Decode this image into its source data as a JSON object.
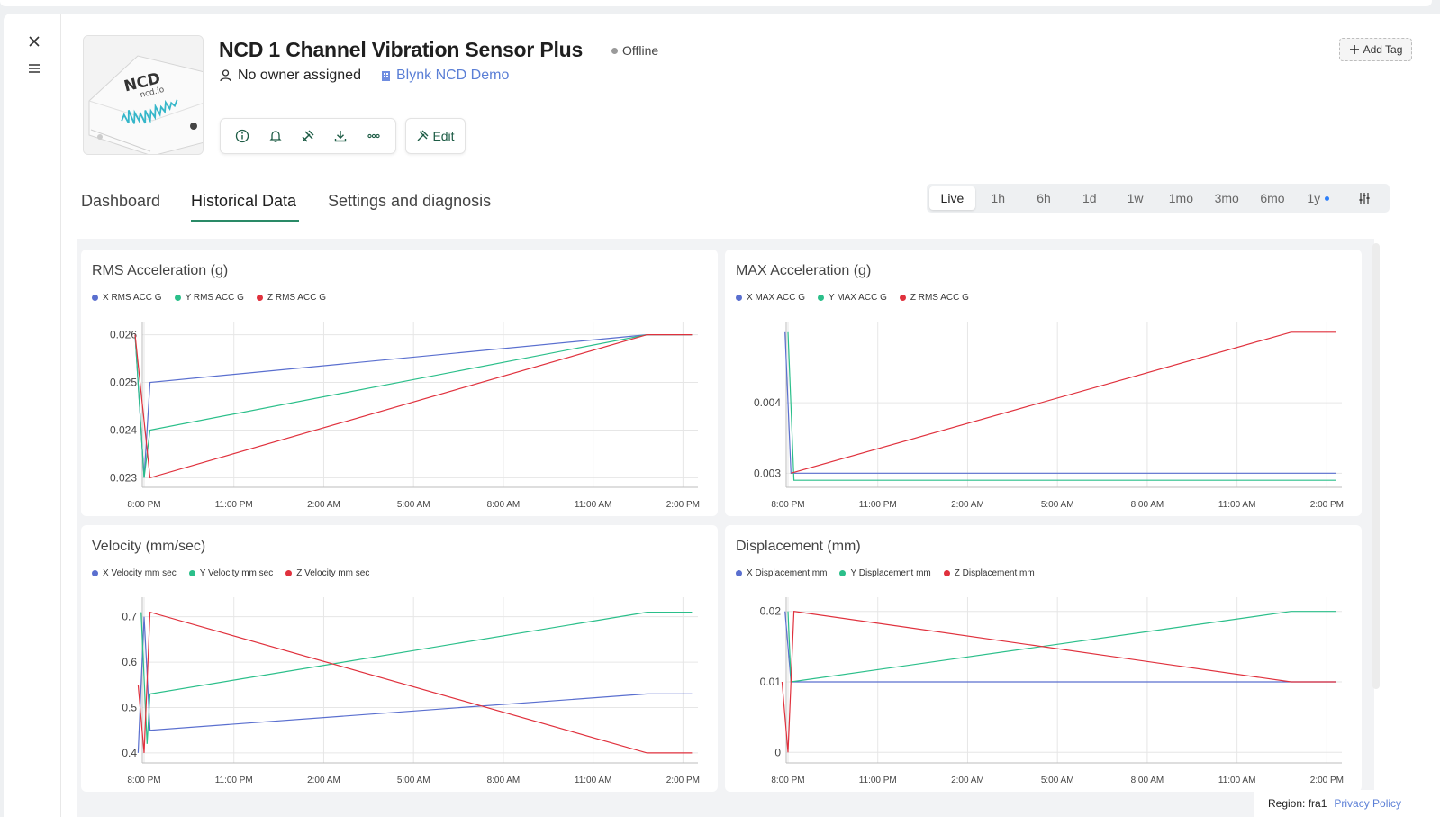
{
  "device": {
    "title": "NCD 1 Channel Vibration Sensor Plus",
    "status": "Offline",
    "owner": "No owner assigned",
    "organization": "Blynk NCD Demo",
    "add_tag_label": "Add Tag",
    "edit_label": "Edit",
    "thumbnail": {
      "logo_text": "NCD",
      "brand_text": "ncd.io"
    }
  },
  "tabs": [
    {
      "label": "Dashboard",
      "active": false
    },
    {
      "label": "Historical Data",
      "active": true
    },
    {
      "label": "Settings and diagnosis",
      "active": false
    }
  ],
  "time_ranges": [
    "Live",
    "1h",
    "6h",
    "1d",
    "1w",
    "1mo",
    "3mo",
    "6mo",
    "1y"
  ],
  "active_range": "Live",
  "colors": {
    "series_x": "#5a6fcf",
    "series_y": "#2bbf8a",
    "series_z": "#e0313d",
    "accent": "#2a8a67",
    "link": "#5b7fd6"
  },
  "footer": {
    "region": "Region: fra1",
    "privacy": "Privacy Policy"
  },
  "chart_data": [
    {
      "type": "line",
      "title": "RMS Acceleration (g)",
      "x": [
        "8:00 PM",
        "11:00 PM",
        "2:00 AM",
        "5:00 AM",
        "8:00 AM",
        "11:00 AM",
        "2:00 PM"
      ],
      "x_range": [
        0,
        18.5
      ],
      "ylim": [
        0.0228,
        0.0262
      ],
      "yticks": [
        "0.023",
        "0.024",
        "0.025",
        "0.026"
      ],
      "ytick_values": [
        0.023,
        0.024,
        0.025,
        0.026
      ],
      "series": [
        {
          "name": "X RMS ACC G",
          "color": "#5a6fcf",
          "points": [
            [
              -0.3,
              0.026
            ],
            [
              0,
              0.023
            ],
            [
              0.2,
              0.025
            ],
            [
              16.8,
              0.026
            ],
            [
              18.3,
              0.026
            ]
          ]
        },
        {
          "name": "Y RMS ACC G",
          "color": "#2bbf8a",
          "points": [
            [
              -0.3,
              0.026
            ],
            [
              0,
              0.023
            ],
            [
              0.2,
              0.024
            ],
            [
              16.8,
              0.026
            ],
            [
              18.3,
              0.026
            ]
          ]
        },
        {
          "name": "Z RMS ACC G",
          "color": "#e0313d",
          "points": [
            [
              -0.3,
              0.026
            ],
            [
              0.2,
              0.023
            ],
            [
              16.8,
              0.026
            ],
            [
              18.3,
              0.026
            ]
          ]
        }
      ]
    },
    {
      "type": "line",
      "title": "MAX Acceleration (g)",
      "x": [
        "8:00 PM",
        "11:00 PM",
        "2:00 AM",
        "5:00 AM",
        "8:00 AM",
        "11:00 AM",
        "2:00 PM"
      ],
      "x_range": [
        0,
        18.5
      ],
      "ylim": [
        0.0028,
        0.0051
      ],
      "yticks": [
        "0.003",
        "0.004"
      ],
      "ytick_values": [
        0.003,
        0.004
      ],
      "series": [
        {
          "name": "X MAX ACC G",
          "color": "#5a6fcf",
          "points": [
            [
              -0.1,
              0.005
            ],
            [
              0.1,
              0.003
            ],
            [
              18.3,
              0.003
            ]
          ]
        },
        {
          "name": "Y MAX ACC G",
          "color": "#2bbf8a",
          "points": [
            [
              0,
              0.005
            ],
            [
              0.2,
              0.0029
            ],
            [
              18.3,
              0.0029
            ]
          ]
        },
        {
          "name": "Z RMS ACC G",
          "color": "#e0313d",
          "points": [
            [
              0.1,
              0.003
            ],
            [
              16.8,
              0.005
            ],
            [
              18.3,
              0.005
            ]
          ]
        }
      ]
    },
    {
      "type": "line",
      "title": "Velocity (mm/sec)",
      "x": [
        "8:00 PM",
        "11:00 PM",
        "2:00 AM",
        "5:00 AM",
        "8:00 AM",
        "11:00 AM",
        "2:00 PM"
      ],
      "x_range": [
        0,
        18.5
      ],
      "ylim": [
        0.378,
        0.735
      ],
      "yticks": [
        "0.4",
        "0.5",
        "0.6",
        "0.7"
      ],
      "ytick_values": [
        0.4,
        0.5,
        0.6,
        0.7
      ],
      "series": [
        {
          "name": "X Velocity mm sec",
          "color": "#5a6fcf",
          "points": [
            [
              -0.2,
              0.4
            ],
            [
              0,
              0.7
            ],
            [
              0.2,
              0.45
            ],
            [
              16.8,
              0.53
            ],
            [
              18.3,
              0.53
            ]
          ]
        },
        {
          "name": "Y Velocity mm sec",
          "color": "#2bbf8a",
          "points": [
            [
              -0.1,
              0.71
            ],
            [
              0.1,
              0.42
            ],
            [
              0.2,
              0.53
            ],
            [
              16.8,
              0.71
            ],
            [
              18.3,
              0.71
            ]
          ]
        },
        {
          "name": "Z Velocity mm sec",
          "color": "#e0313d",
          "points": [
            [
              -0.2,
              0.55
            ],
            [
              0,
              0.4
            ],
            [
              0.2,
              0.71
            ],
            [
              16.8,
              0.4
            ],
            [
              18.3,
              0.4
            ]
          ]
        }
      ]
    },
    {
      "type": "line",
      "title": "Displacement (mm)",
      "x": [
        "8:00 PM",
        "11:00 PM",
        "2:00 AM",
        "5:00 AM",
        "8:00 AM",
        "11:00 AM",
        "2:00 PM"
      ],
      "x_range": [
        0,
        18.5
      ],
      "ylim": [
        -0.0015,
        0.0215
      ],
      "yticks": [
        "0",
        "0.01",
        "0.02"
      ],
      "ytick_values": [
        0,
        0.01,
        0.02
      ],
      "series": [
        {
          "name": "X Displacement mm",
          "color": "#5a6fcf",
          "points": [
            [
              -0.1,
              0.02
            ],
            [
              0.1,
              0.01
            ],
            [
              16.8,
              0.01
            ],
            [
              18.3,
              0.01
            ]
          ]
        },
        {
          "name": "Y Displacement mm",
          "color": "#2bbf8a",
          "points": [
            [
              0,
              0.02
            ],
            [
              0.1,
              0.01
            ],
            [
              16.8,
              0.02
            ],
            [
              18.3,
              0.02
            ]
          ]
        },
        {
          "name": "Z Displacement mm",
          "color": "#e0313d",
          "points": [
            [
              -0.2,
              0.01
            ],
            [
              0,
              0.0
            ],
            [
              0.2,
              0.02
            ],
            [
              16.8,
              0.01
            ],
            [
              18.3,
              0.01
            ]
          ]
        }
      ]
    }
  ]
}
